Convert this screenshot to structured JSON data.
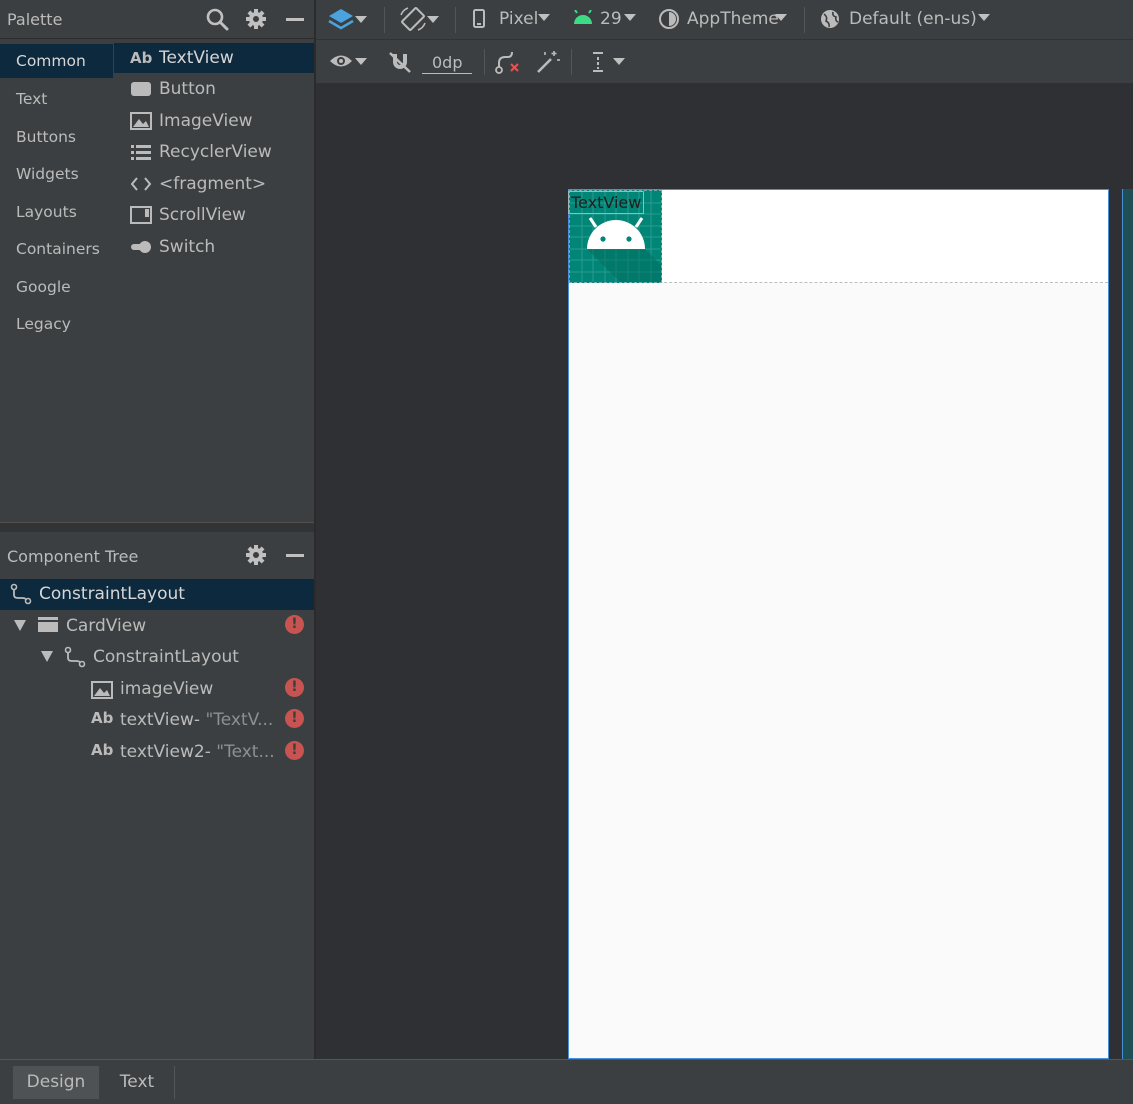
{
  "palette": {
    "title": "Palette",
    "categories": [
      {
        "label": "Common",
        "selected": true
      },
      {
        "label": "Text"
      },
      {
        "label": "Buttons"
      },
      {
        "label": "Widgets"
      },
      {
        "label": "Layouts"
      },
      {
        "label": "Containers"
      },
      {
        "label": "Google"
      },
      {
        "label": "Legacy"
      }
    ],
    "items": [
      {
        "label": "TextView",
        "icon": "textview-icon",
        "glyph": "Ab",
        "selected": true
      },
      {
        "label": "Button",
        "icon": "button-icon"
      },
      {
        "label": "ImageView",
        "icon": "imageview-icon"
      },
      {
        "label": "RecyclerView",
        "icon": "recyclerview-icon"
      },
      {
        "label": "<fragment>",
        "icon": "fragment-icon",
        "glyph": "<>"
      },
      {
        "label": "ScrollView",
        "icon": "scrollview-icon"
      },
      {
        "label": "Switch",
        "icon": "switch-icon"
      }
    ]
  },
  "component_tree": {
    "title": "Component Tree",
    "nodes": [
      {
        "label": "ConstraintLayout",
        "icon": "constraint-layout-icon",
        "selected": true
      },
      {
        "label": "CardView",
        "icon": "cardview-icon",
        "error": true
      },
      {
        "label": "ConstraintLayout",
        "icon": "constraint-layout-icon"
      },
      {
        "label": "imageView",
        "icon": "imageview-icon",
        "error": true
      },
      {
        "label": "textView-",
        "detail": "\"TextV...",
        "icon": "textview-icon",
        "glyph": "Ab",
        "error": true
      },
      {
        "label": "textView2-",
        "detail": "\"Text...",
        "icon": "textview-icon",
        "glyph": "Ab",
        "error": true
      }
    ]
  },
  "toolbar": {
    "device": "Pixel",
    "api_level": "29",
    "theme": "AppTheme",
    "locale": "Default (en-us)",
    "default_margin": "0dp"
  },
  "canvas": {
    "textview_label": "TextView",
    "image_bg_color": "#008577",
    "selection_color": "#4a90d9"
  },
  "bottom_tabs": [
    {
      "label": "Design",
      "selected": true
    },
    {
      "label": "Text"
    }
  ],
  "colors": {
    "panel_bg": "#3c3f41",
    "selection_bg": "#0d293e",
    "error_red": "#c75450",
    "android_green": "#3ddc84"
  }
}
